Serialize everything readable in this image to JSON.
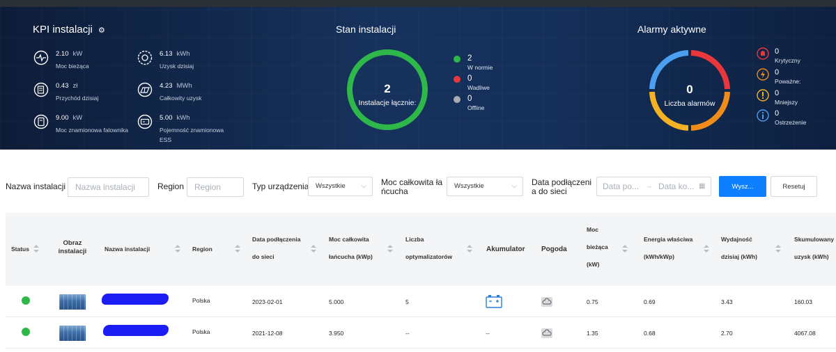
{
  "kpi": {
    "title": "KPI instalacji",
    "items": [
      {
        "value": "2.10",
        "unit": "kW",
        "label": "Moc bieżąca"
      },
      {
        "value": "6.13",
        "unit": "kWh",
        "label": "Uzysk dzisiaj"
      },
      {
        "value": "0.43",
        "unit": "zł",
        "label": "Przychód dzisiaj"
      },
      {
        "value": "4.23",
        "unit": "MWh",
        "label": "Całkowity uzysk"
      },
      {
        "value": "9.00",
        "unit": "kW",
        "label": "Moc znamionowa falownika"
      },
      {
        "value": "5.00",
        "unit": "kWh",
        "label": "Pojemność znamionowa ESS"
      }
    ]
  },
  "status": {
    "title": "Stan instalacji",
    "total": "2",
    "total_label": "Instalacje łącznie:",
    "legend": [
      {
        "value": "2",
        "label": "W normie",
        "color": "#2fb84a"
      },
      {
        "value": "0",
        "label": "Wadliwe",
        "color": "#e8383d"
      },
      {
        "value": "0",
        "label": "Offline",
        "color": "#a8abb0"
      }
    ]
  },
  "alarms": {
    "title": "Alarmy aktywne",
    "total": "0",
    "total_label": "Liczba alarmów",
    "items": [
      {
        "value": "0",
        "label": "Krytyczny",
        "color": "#e8383d"
      },
      {
        "value": "0",
        "label": "Poważne:",
        "color": "#f08c1a"
      },
      {
        "value": "0",
        "label": "Mniejszy",
        "color": "#f5b324"
      },
      {
        "value": "0",
        "label": "Ostrzeżenie",
        "color": "#4a9ff0"
      }
    ]
  },
  "filters": {
    "name_label": "Nazwa instalacji",
    "name_placeholder": "Nazwa instalacji",
    "region_label": "Region",
    "region_placeholder": "Region",
    "device_label": "Typ urządzenia",
    "device_value": "Wszystkie",
    "power_label_1": "Moc całkowita ła",
    "power_label_2": "ńcucha",
    "power_value": "Wszystkie",
    "date_label_1": "Data podłączeni",
    "date_label_2": "a do sieci",
    "date_start_placeholder": "Data po...",
    "date_end_placeholder": "Data ko...",
    "search_button": "Wysz...",
    "reset_button": "Resetuj"
  },
  "table": {
    "headers": {
      "status": "Status",
      "image_1": "Obraz",
      "image_2": "instalacji",
      "name": "Nazwa instalacji",
      "region": "Region",
      "date_1": "Data podłączenia",
      "date_2": "do sieci",
      "power_1": "Moc całkowita",
      "power_2": "łańcucha (kWp)",
      "optim_1": "Liczba",
      "optim_2": "optymalizatorów",
      "battery": "Akumulator",
      "weather": "Pogoda",
      "cur_1": "Moc",
      "cur_2": "bieżąca",
      "cur_3": "(kW)",
      "spec_1": "Energia właściwa",
      "spec_2": "(kWh/kWp)",
      "yield_1": "Wydajność",
      "yield_2": "dzisiaj (kWh)",
      "cum_1": "Skumulowany",
      "cum_2": "uzysk (kWh)"
    },
    "rows": [
      {
        "region": "Polska",
        "date": "2023-02-01",
        "power": "5.000",
        "optim": "5",
        "battery": "battery-icon",
        "current": "0.75",
        "specific": "0.69",
        "yield": "3.43",
        "cumulative": "160.03"
      },
      {
        "region": "Polska",
        "date": "2021-12-08",
        "power": "3.950",
        "optim": "--",
        "battery": "--",
        "current": "1.35",
        "specific": "0.68",
        "yield": "2.70",
        "cumulative": "4067.08"
      }
    ]
  }
}
